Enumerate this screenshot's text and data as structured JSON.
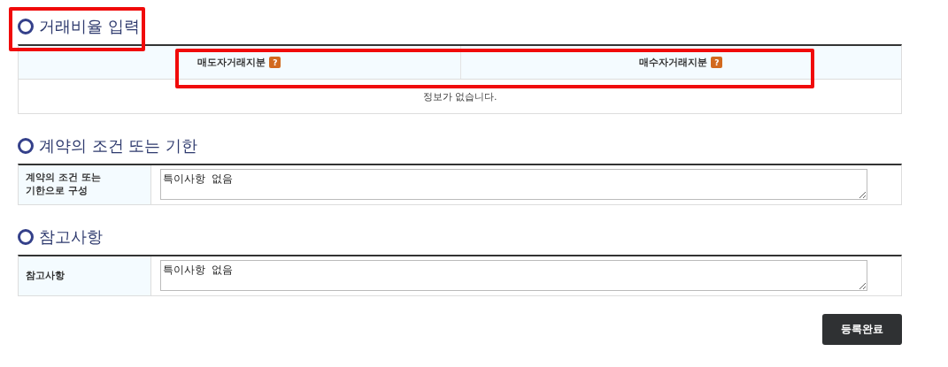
{
  "sections": [
    {
      "kind": "grid",
      "title": "거래비율 입력",
      "columns": [
        {
          "label": "매도자거래지분"
        },
        {
          "label": "매수자거래지분"
        }
      ],
      "empty_message": "정보가 없습니다."
    },
    {
      "kind": "form",
      "title": "계약의 조건 또는 기한",
      "label": "계약의 조건 또는\n기한으로 구성",
      "value": "특이사항 없음"
    },
    {
      "kind": "form",
      "title": "참고사항",
      "label": "참고사항",
      "value": "특이사항 없음"
    }
  ],
  "help_mark": "?",
  "submit_button": "등록완료"
}
